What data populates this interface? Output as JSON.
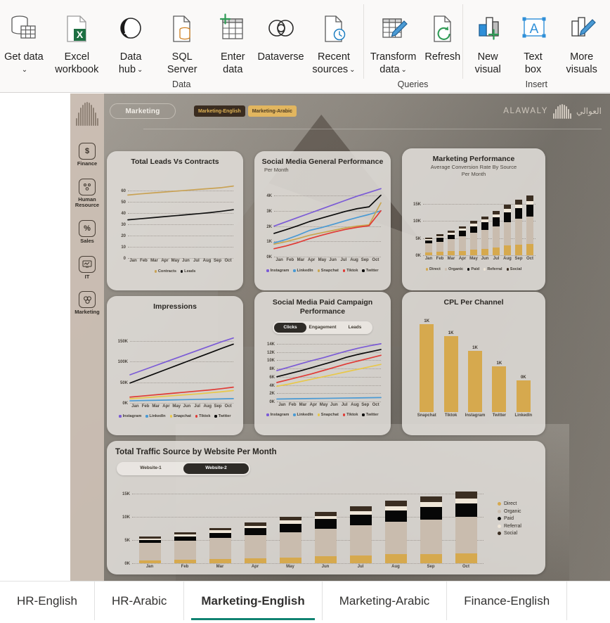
{
  "ribbon": {
    "groups": [
      {
        "label": "Data",
        "items": [
          {
            "name": "get-data",
            "label": "Get data",
            "icon": "database-table-icon",
            "caret": true
          },
          {
            "name": "excel-workbook",
            "label": "Excel workbook",
            "icon": "excel-file-icon",
            "caret": false
          },
          {
            "name": "data-hub",
            "label": "Data hub",
            "icon": "data-hub-icon",
            "caret": true
          },
          {
            "name": "sql-server",
            "label": "SQL Server",
            "icon": "sql-server-icon",
            "caret": false
          },
          {
            "name": "enter-data",
            "label": "Enter data",
            "icon": "enter-data-grid-icon",
            "caret": false
          },
          {
            "name": "dataverse",
            "label": "Dataverse",
            "icon": "dataverse-icon",
            "caret": false
          },
          {
            "name": "recent-sources",
            "label": "Recent sources",
            "icon": "recent-sources-clock-icon",
            "caret": true
          }
        ]
      },
      {
        "label": "Queries",
        "items": [
          {
            "name": "transform-data",
            "label": "Transform data",
            "icon": "transform-pencil-icon",
            "caret": true
          },
          {
            "name": "refresh",
            "label": "Refresh",
            "icon": "refresh-circular-arrow-icon",
            "caret": false
          }
        ]
      },
      {
        "label": "Insert",
        "items": [
          {
            "name": "new-visual",
            "label": "New visual",
            "icon": "new-visual-chart-plus-icon",
            "caret": false
          },
          {
            "name": "text-box",
            "label": "Text box",
            "icon": "text-box-a-icon",
            "caret": false
          },
          {
            "name": "more-visuals",
            "label": "More visuals",
            "icon": "more-visuals-pencil-icon",
            "caret": false
          }
        ]
      }
    ]
  },
  "report": {
    "rail": {
      "logo": "alawaly-bars-logo",
      "items": [
        {
          "label": "Finance",
          "icon": "dollar-icon",
          "glyph": "$"
        },
        {
          "label": "Human Resource",
          "icon": "people-grid-icon",
          "glyph": "⚇"
        },
        {
          "label": "Sales",
          "icon": "percent-icon",
          "glyph": "%"
        },
        {
          "label": "IT",
          "icon": "monitor-icon",
          "glyph": "▢"
        },
        {
          "label": "Marketing",
          "icon": "megaphone-circles-icon",
          "glyph": "⊛"
        }
      ]
    },
    "header": {
      "section_pill": "Marketing",
      "lang_active": "Marketing-English",
      "lang_inactive": "Marketing-Arabic",
      "brand_en": "ALAWALY",
      "brand_ar": "العوالي"
    },
    "colors": {
      "instagram": "#7B5BD6",
      "linkedin": "#4A9AD4",
      "snapchat": "#E8C84A",
      "snapchat_muted": "#C9A54E",
      "tiktok": "#E03B36",
      "twitter": "#0B0B0B",
      "contracts": "#C9A254",
      "leads": "#111111",
      "direct": "#D6A94E",
      "organic": "#C9BCAE",
      "paid": "#070707",
      "referral": "#EFE6D8",
      "social": "#3B2E22",
      "accent_teal": "#118372"
    }
  },
  "chart_data": [
    {
      "id": "total-leads-vs-contracts",
      "type": "line",
      "title": "Total Leads Vs Contracts",
      "subtitle": "",
      "x": [
        "Jan",
        "Feb",
        "Mar",
        "Apr",
        "May",
        "Jun",
        "Jul",
        "Aug",
        "Sep",
        "Oct"
      ],
      "ylim": [
        0,
        65
      ],
      "yticks": [
        0,
        10,
        20,
        30,
        40,
        50,
        60
      ],
      "yticklabels": [
        "0",
        "10",
        "20",
        "30",
        "40",
        "50",
        "60"
      ],
      "grid": true,
      "legend_position": "bottom",
      "series": [
        {
          "name": "Contracts",
          "color": "#C9A254",
          "values": [
            56,
            57,
            57.8,
            58.6,
            59.4,
            60.2,
            61,
            61.8,
            62.6,
            64
          ]
        },
        {
          "name": "Leads",
          "color": "#111111",
          "values": [
            34,
            34.9,
            35.8,
            36.7,
            37.6,
            38.5,
            39.4,
            40.4,
            41.6,
            43
          ]
        }
      ]
    },
    {
      "id": "social-media-general-performance",
      "type": "line",
      "title": "Social Media General Performance",
      "subtitle": "Per Month",
      "x": [
        "Jan",
        "Feb",
        "Mar",
        "Apr",
        "May",
        "Jun",
        "Jul",
        "Aug",
        "Sep",
        "Oct"
      ],
      "ylim": [
        0,
        4600
      ],
      "yticks": [
        0,
        1000,
        2000,
        3000,
        4000
      ],
      "yticklabels": [
        "0K",
        "1K",
        "2K",
        "3K",
        "4K"
      ],
      "grid": true,
      "legend_position": "bottom",
      "series": [
        {
          "name": "Instagram",
          "color": "#7B5BD6",
          "values": [
            2000,
            2280,
            2560,
            2840,
            3120,
            3400,
            3680,
            3960,
            4200,
            4450
          ]
        },
        {
          "name": "LinkedIn",
          "color": "#4A9AD4",
          "values": [
            900,
            1120,
            1400,
            1720,
            1900,
            2120,
            2350,
            2560,
            2760,
            3000
          ]
        },
        {
          "name": "Snapchat",
          "color": "#C9A54E",
          "values": [
            820,
            980,
            1180,
            1400,
            1560,
            1720,
            1880,
            2000,
            2080,
            3520
          ]
        },
        {
          "name": "Tiktok",
          "color": "#E03B36",
          "values": [
            520,
            700,
            920,
            1180,
            1400,
            1600,
            1780,
            1920,
            2020,
            3000
          ]
        },
        {
          "name": "Twitter",
          "color": "#0B0B0B",
          "values": [
            1520,
            1760,
            2020,
            2300,
            2520,
            2740,
            2960,
            3140,
            3260,
            4020
          ]
        }
      ]
    },
    {
      "id": "marketing-performance",
      "type": "bar",
      "stacked": true,
      "title": "Marketing Performance",
      "subtitle": "Average Conversion Rate By Source\nPer Month",
      "categories": [
        "Jan",
        "Feb",
        "Mar",
        "Apr",
        "May",
        "Jun",
        "Jul",
        "Aug",
        "Sep",
        "Oct"
      ],
      "ylim": [
        0,
        18500
      ],
      "yticks": [
        0,
        5000,
        10000,
        15000
      ],
      "yticklabels": [
        "0K",
        "5K",
        "10K",
        "15K"
      ],
      "grid": true,
      "legend_position": "bottom",
      "series": [
        {
          "name": "Direct",
          "color": "#D6A94E",
          "values": [
            900,
            1000,
            1150,
            1300,
            1600,
            1900,
            2300,
            2800,
            3000,
            3200
          ]
        },
        {
          "name": "Organic",
          "color": "#C9BCAE",
          "values": [
            2500,
            3000,
            3500,
            4200,
            4900,
            5500,
            6200,
            6900,
            7600,
            8200
          ]
        },
        {
          "name": "Paid",
          "color": "#070707",
          "values": [
            1000,
            1200,
            1400,
            1700,
            2000,
            2300,
            2600,
            2900,
            3200,
            3400
          ]
        },
        {
          "name": "Referral",
          "color": "#EFE6D8",
          "values": [
            400,
            450,
            520,
            600,
            680,
            760,
            840,
            900,
            960,
            1050
          ]
        },
        {
          "name": "Social",
          "color": "#3B2E22",
          "values": [
            400,
            500,
            620,
            720,
            830,
            950,
            1080,
            1250,
            1400,
            1600
          ]
        }
      ]
    },
    {
      "id": "impressions",
      "type": "line",
      "title": "Impressions",
      "subtitle": "",
      "x": [
        "Jan",
        "Feb",
        "Mar",
        "Apr",
        "May",
        "Jun",
        "Jul",
        "Aug",
        "Sep",
        "Oct"
      ],
      "ylim": [
        0,
        170000
      ],
      "yticks": [
        0,
        50000,
        100000,
        150000
      ],
      "yticklabels": [
        "0K",
        "50K",
        "100K",
        "150K"
      ],
      "grid": true,
      "legend_position": "bottom",
      "series": [
        {
          "name": "Instagram",
          "color": "#7B5BD6",
          "values": [
            68000,
            78000,
            88000,
            98000,
            108000,
            118000,
            128000,
            138000,
            148000,
            157000
          ]
        },
        {
          "name": "LinkedIn",
          "color": "#4A9AD4",
          "values": [
            5000,
            5600,
            6200,
            6800,
            7400,
            8000,
            8600,
            9200,
            9800,
            10400
          ]
        },
        {
          "name": "Snapchat",
          "color": "#E8C84A",
          "values": [
            10000,
            12000,
            14000,
            16000,
            18000,
            20000,
            22000,
            24500,
            27000,
            30000
          ]
        },
        {
          "name": "Tiktok",
          "color": "#E03B36",
          "values": [
            14000,
            16500,
            19000,
            21500,
            24000,
            26500,
            29000,
            31500,
            34500,
            38000
          ]
        },
        {
          "name": "Twitter",
          "color": "#0B0B0B",
          "values": [
            48000,
            58500,
            69000,
            79500,
            90000,
            100500,
            111000,
            121500,
            132000,
            142000
          ]
        }
      ]
    },
    {
      "id": "social-media-paid-campaign-performance",
      "type": "line",
      "title": "Social Media Paid Campaign Performance",
      "subtitle": "",
      "tabs": [
        "Clicks",
        "Engagement",
        "Leads"
      ],
      "active_tab": "Clicks",
      "x": [
        "Jan",
        "Feb",
        "Mar",
        "Apr",
        "May",
        "Jun",
        "Jul",
        "Aug",
        "Sep",
        "Oct"
      ],
      "ylim": [
        0,
        15000
      ],
      "yticks": [
        0,
        2000,
        4000,
        6000,
        8000,
        10000,
        12000,
        14000
      ],
      "yticklabels": [
        "0K",
        "2K",
        "4K",
        "6K",
        "8K",
        "10K",
        "12K",
        "14K"
      ],
      "grid": true,
      "legend_position": "bottom",
      "series": [
        {
          "name": "Instagram",
          "color": "#7B5BD6",
          "values": [
            7500,
            8300,
            9100,
            9900,
            10600,
            11400,
            12200,
            12900,
            13500,
            14000
          ]
        },
        {
          "name": "LinkedIn",
          "color": "#4A9AD4",
          "values": [
            600,
            640,
            680,
            720,
            760,
            800,
            840,
            880,
            920,
            960
          ]
        },
        {
          "name": "Snapchat",
          "color": "#E8C84A",
          "values": [
            3700,
            4200,
            4800,
            5400,
            6000,
            6600,
            7200,
            7800,
            8400,
            9000
          ]
        },
        {
          "name": "Tiktok",
          "color": "#E03B36",
          "values": [
            4600,
            5300,
            6000,
            6700,
            7500,
            8300,
            9100,
            9800,
            10500,
            11200
          ]
        },
        {
          "name": "Twitter",
          "color": "#0B0B0B",
          "values": [
            6000,
            6700,
            7400,
            8200,
            9000,
            9800,
            10700,
            11400,
            12000,
            12600
          ]
        }
      ]
    },
    {
      "id": "cpl-per-channel",
      "type": "bar",
      "stacked": false,
      "title": "CPL Per Channel",
      "categories": [
        "Snapchat",
        "Tiktok",
        "Instagram",
        "Twitter",
        "LinkedIn"
      ],
      "values": [
        1000,
        870,
        700,
        520,
        360
      ],
      "datalabels": [
        "1K",
        "1K",
        "1K",
        "1K",
        "0K"
      ],
      "bar_color": "#D6A94E",
      "ylim": [
        0,
        1100
      ],
      "grid": false,
      "legend_position": "none"
    },
    {
      "id": "total-traffic-source-by-website",
      "type": "bar",
      "stacked": true,
      "title": "Total Traffic Source by Website Per Month",
      "tabs": [
        "Website-1",
        "Website-2"
      ],
      "active_tab": "Website-2",
      "categories": [
        "Jan",
        "Feb",
        "Mar",
        "Apr",
        "May",
        "Jun",
        "Jul",
        "Aug",
        "Sep",
        "Oct"
      ],
      "ylim": [
        0,
        17000
      ],
      "yticks": [
        0,
        5000,
        10000,
        15000
      ],
      "yticklabels": [
        "0K",
        "5K",
        "10K",
        "15K"
      ],
      "grid": true,
      "legend_position": "right",
      "series": [
        {
          "name": "Direct",
          "color": "#D6A94E",
          "values": [
            650,
            800,
            900,
            1050,
            1250,
            1450,
            1650,
            1900,
            2050,
            2200
          ]
        },
        {
          "name": "Organic",
          "color": "#C9BCAE",
          "values": [
            3700,
            4100,
            4500,
            5000,
            5500,
            6000,
            6500,
            7000,
            7400,
            7800
          ]
        },
        {
          "name": "Paid",
          "color": "#070707",
          "values": [
            700,
            900,
            1200,
            1500,
            1800,
            2050,
            2300,
            2550,
            2750,
            2950
          ]
        },
        {
          "name": "Referral",
          "color": "#EFE6D8",
          "values": [
            300,
            380,
            480,
            560,
            640,
            720,
            800,
            880,
            950,
            1020
          ]
        },
        {
          "name": "Social",
          "color": "#3B2E22",
          "values": [
            350,
            450,
            560,
            680,
            800,
            920,
            1050,
            1180,
            1300,
            1450
          ]
        }
      ]
    }
  ],
  "tabbar": {
    "tabs": [
      {
        "label": "HR-English",
        "active": false
      },
      {
        "label": "HR-Arabic",
        "active": false
      },
      {
        "label": "Marketing-English",
        "active": true
      },
      {
        "label": "Marketing-Arabic",
        "active": false
      },
      {
        "label": "Finance-English",
        "active": false
      }
    ]
  }
}
